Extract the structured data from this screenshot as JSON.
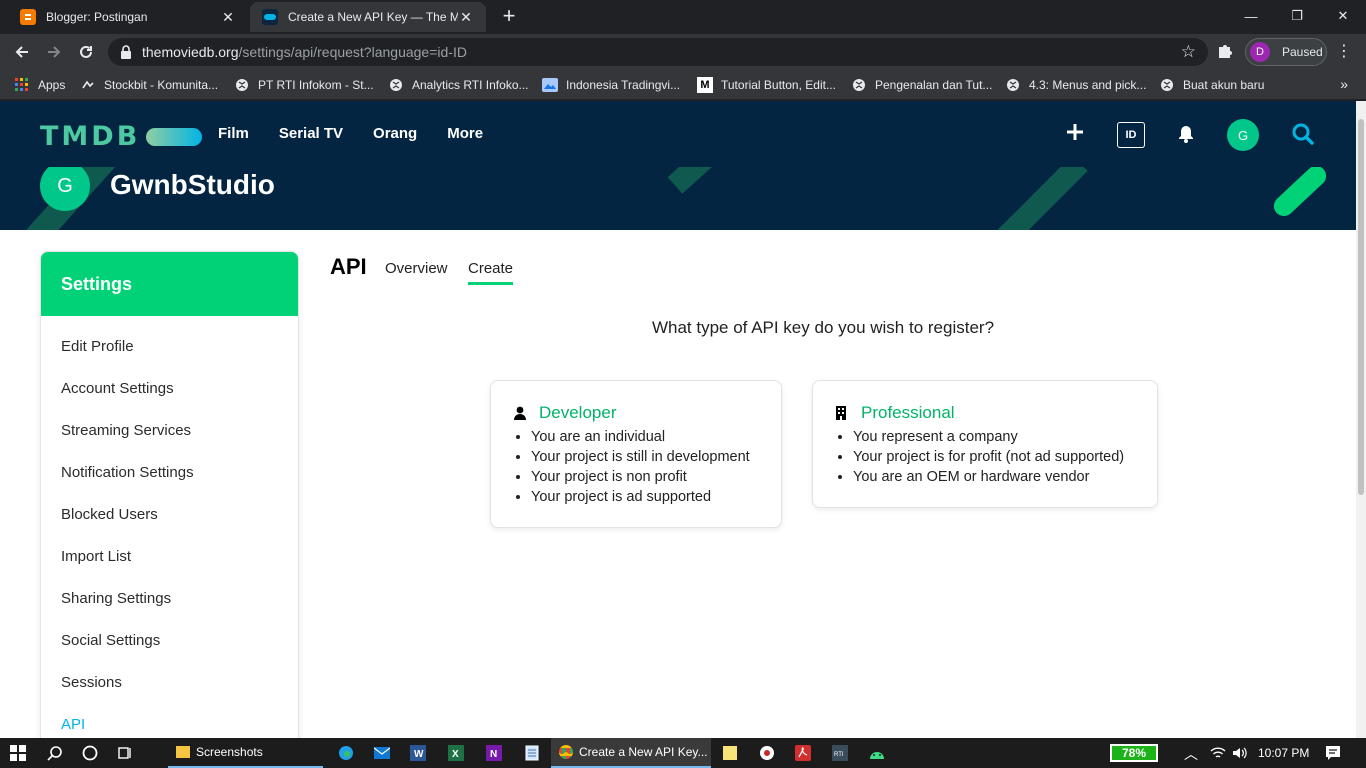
{
  "browser": {
    "tabs": [
      {
        "title": "Blogger: Postingan",
        "favicon_color": "#f57c00"
      },
      {
        "title": "Create a New API Key — The Mo",
        "favicon_color": "#0d253f"
      }
    ],
    "url_host": "themoviedb.org",
    "url_path": "/settings/api/request?language=id-ID",
    "profile_initial": "D",
    "profile_status": "Paused",
    "bookmarks": [
      {
        "label": "Apps",
        "icon": "apps-grid-icon"
      },
      {
        "label": "Stockbit - Komunita...",
        "icon": "stockbit-icon"
      },
      {
        "label": "PT RTI Infokom - St...",
        "icon": "globe-icon"
      },
      {
        "label": "Analytics RTI Infoko...",
        "icon": "globe-icon"
      },
      {
        "label": "Indonesia Tradingvi...",
        "icon": "image-icon"
      },
      {
        "label": "Tutorial Button, Edit...",
        "icon": "medium-icon"
      },
      {
        "label": "Pengenalan dan Tut...",
        "icon": "globe-icon"
      },
      {
        "label": "4.3: Menus and pick...",
        "icon": "globe-icon"
      },
      {
        "label": "Buat akun baru",
        "icon": "globe-icon"
      }
    ]
  },
  "header": {
    "logo_text": "TMDB",
    "nav": [
      "Film",
      "Serial TV",
      "Orang",
      "More"
    ],
    "lang": "ID",
    "avatar_initial": "G"
  },
  "banner": {
    "avatar_initial": "G",
    "username": "GwnbStudio"
  },
  "sidebar": {
    "heading": "Settings",
    "items": [
      "Edit Profile",
      "Account Settings",
      "Streaming Services",
      "Notification Settings",
      "Blocked Users",
      "Import List",
      "Sharing Settings",
      "Social Settings",
      "Sessions",
      "API"
    ],
    "active_item": "API"
  },
  "main": {
    "title": "API",
    "tabs": [
      "Overview",
      "Create"
    ],
    "active_tab": "Create",
    "question": "What type of API key do you wish to register?",
    "cards": [
      {
        "title": "Developer",
        "icon": "user-icon",
        "points": [
          "You are an individual",
          "Your project is still in development",
          "Your project is non profit",
          "Your project is ad supported"
        ]
      },
      {
        "title": "Professional",
        "icon": "building-icon",
        "points": [
          "You represent a company",
          "Your project is for profit (not ad supported)",
          "You are an OEM or hardware vendor"
        ]
      }
    ]
  },
  "taskbar": {
    "folder_label": "Screenshots",
    "chrome_label": "Create a New API Key...",
    "battery": "78%",
    "time": "10:07 PM"
  },
  "colors": {
    "tmdb_navy": "#032541",
    "tmdb_green": "#01d277",
    "tmdb_blue": "#01b4e4"
  }
}
